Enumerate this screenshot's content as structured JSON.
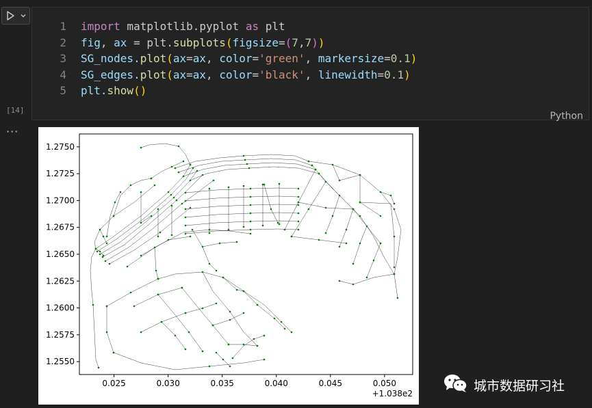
{
  "toolbar": {
    "run_icon": "play-icon",
    "dropdown_icon": "chevron-down-icon"
  },
  "cell": {
    "line_numbers": [
      "1",
      "2",
      "3",
      "4",
      "5"
    ],
    "code": {
      "l1": {
        "kw_import": "import",
        "mod": " matplotlib.pyplot ",
        "kw_as": "as",
        "alias": " plt"
      },
      "l2": {
        "fig": "fig",
        "comma": ", ",
        "ax": "ax",
        "eq": " = plt.",
        "fn": "subplots",
        "p_open": "(",
        "param": "figsize",
        "eq2": "=",
        "t_open": "(",
        "n1": "7",
        "c": ",",
        "n2": "7",
        "t_close": ")",
        "p_close": ")"
      },
      "l3": {
        "obj": "SG_nodes.",
        "fn": "plot",
        "p_open": "(",
        "a1": "ax",
        "eq1": "=",
        "v1": "ax",
        "sep1": ", ",
        "a2": "color",
        "eq2": "=",
        "s2": "'green'",
        "sep2": ", ",
        "a3": "markersize",
        "eq3": "=",
        "n3": "0.1",
        "p_close": ")"
      },
      "l4": {
        "obj": "SG_edges.",
        "fn": "plot",
        "p_open": "(",
        "a1": "ax",
        "eq1": "=",
        "v1": "ax",
        "sep1": ", ",
        "a2": "color",
        "eq2": "=",
        "s2": "'black'",
        "sep2": ", ",
        "a3": "linewidth",
        "eq3": "=",
        "n3": "0.1",
        "p_close": ")"
      },
      "l5": {
        "obj": "plt.",
        "fn": "show",
        "p": "()"
      }
    },
    "execution_count": "[14]",
    "language": "Python"
  },
  "output": {
    "ellipsis": "···"
  },
  "chart_data": {
    "type": "line",
    "x_ticks": [
      "0.025",
      "0.030",
      "0.035",
      "0.040",
      "0.045",
      "0.050"
    ],
    "y_ticks": [
      "1.2750",
      "1.2725",
      "1.2700",
      "1.2675",
      "1.2650",
      "1.2625",
      "1.2600",
      "1.2575",
      "1.2550"
    ],
    "x_offset_label": "+1.038e2",
    "xlim": [
      0.0218,
      0.0526
    ],
    "ylim": [
      1.2538,
      1.2762
    ],
    "edge_color": "#000000",
    "node_color": "#008000"
  },
  "watermark": {
    "text": "城市数据研习社",
    "icon": "wechat-icon"
  }
}
